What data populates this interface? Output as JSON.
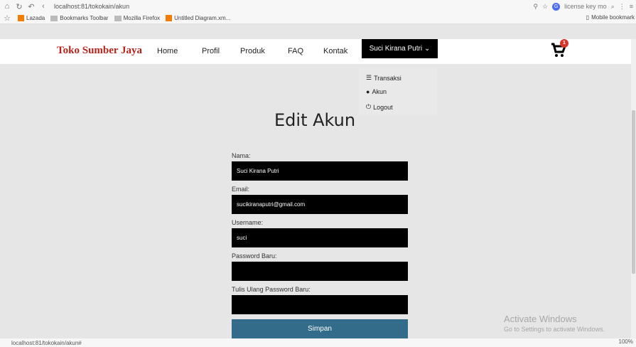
{
  "browser": {
    "url": "localhost:81/tokokain/akun",
    "search_text": "license key mo",
    "bookmarks": [
      "Lazada",
      "Bookmarks Toolbar",
      "Mozilla Firefox",
      "Untitled Diagram.xm..."
    ],
    "mobile_bookmarks": "Mobile bookmark"
  },
  "nav": {
    "brand": "Toko Sumber Jaya",
    "items": [
      "Home",
      "Profil",
      "Produk",
      "FAQ",
      "Kontak"
    ],
    "user": "Suci Kirana Putri",
    "cart_count": "1"
  },
  "dropdown": {
    "items": [
      "Transaksi",
      "Akun",
      "Logout"
    ]
  },
  "page": {
    "title": "Edit Akun"
  },
  "form": {
    "name_label": "Nama:",
    "name_value": "Suci Kirana Putri",
    "email_label": "Email:",
    "email_value": "sucikiranaputri@gmail.com",
    "username_label": "Username:",
    "username_value": "suci",
    "password_label": "Password Baru:",
    "password_value": "",
    "repeat_label": "Tulis Ulang Password Baru:",
    "repeat_value": "",
    "submit_label": "Simpan"
  },
  "watermark": {
    "line1": "Activate Windows",
    "line2": "Go to Settings to activate Windows."
  },
  "status": {
    "url": "localhost:81/tokokain/akun#",
    "zoom": "100%"
  }
}
